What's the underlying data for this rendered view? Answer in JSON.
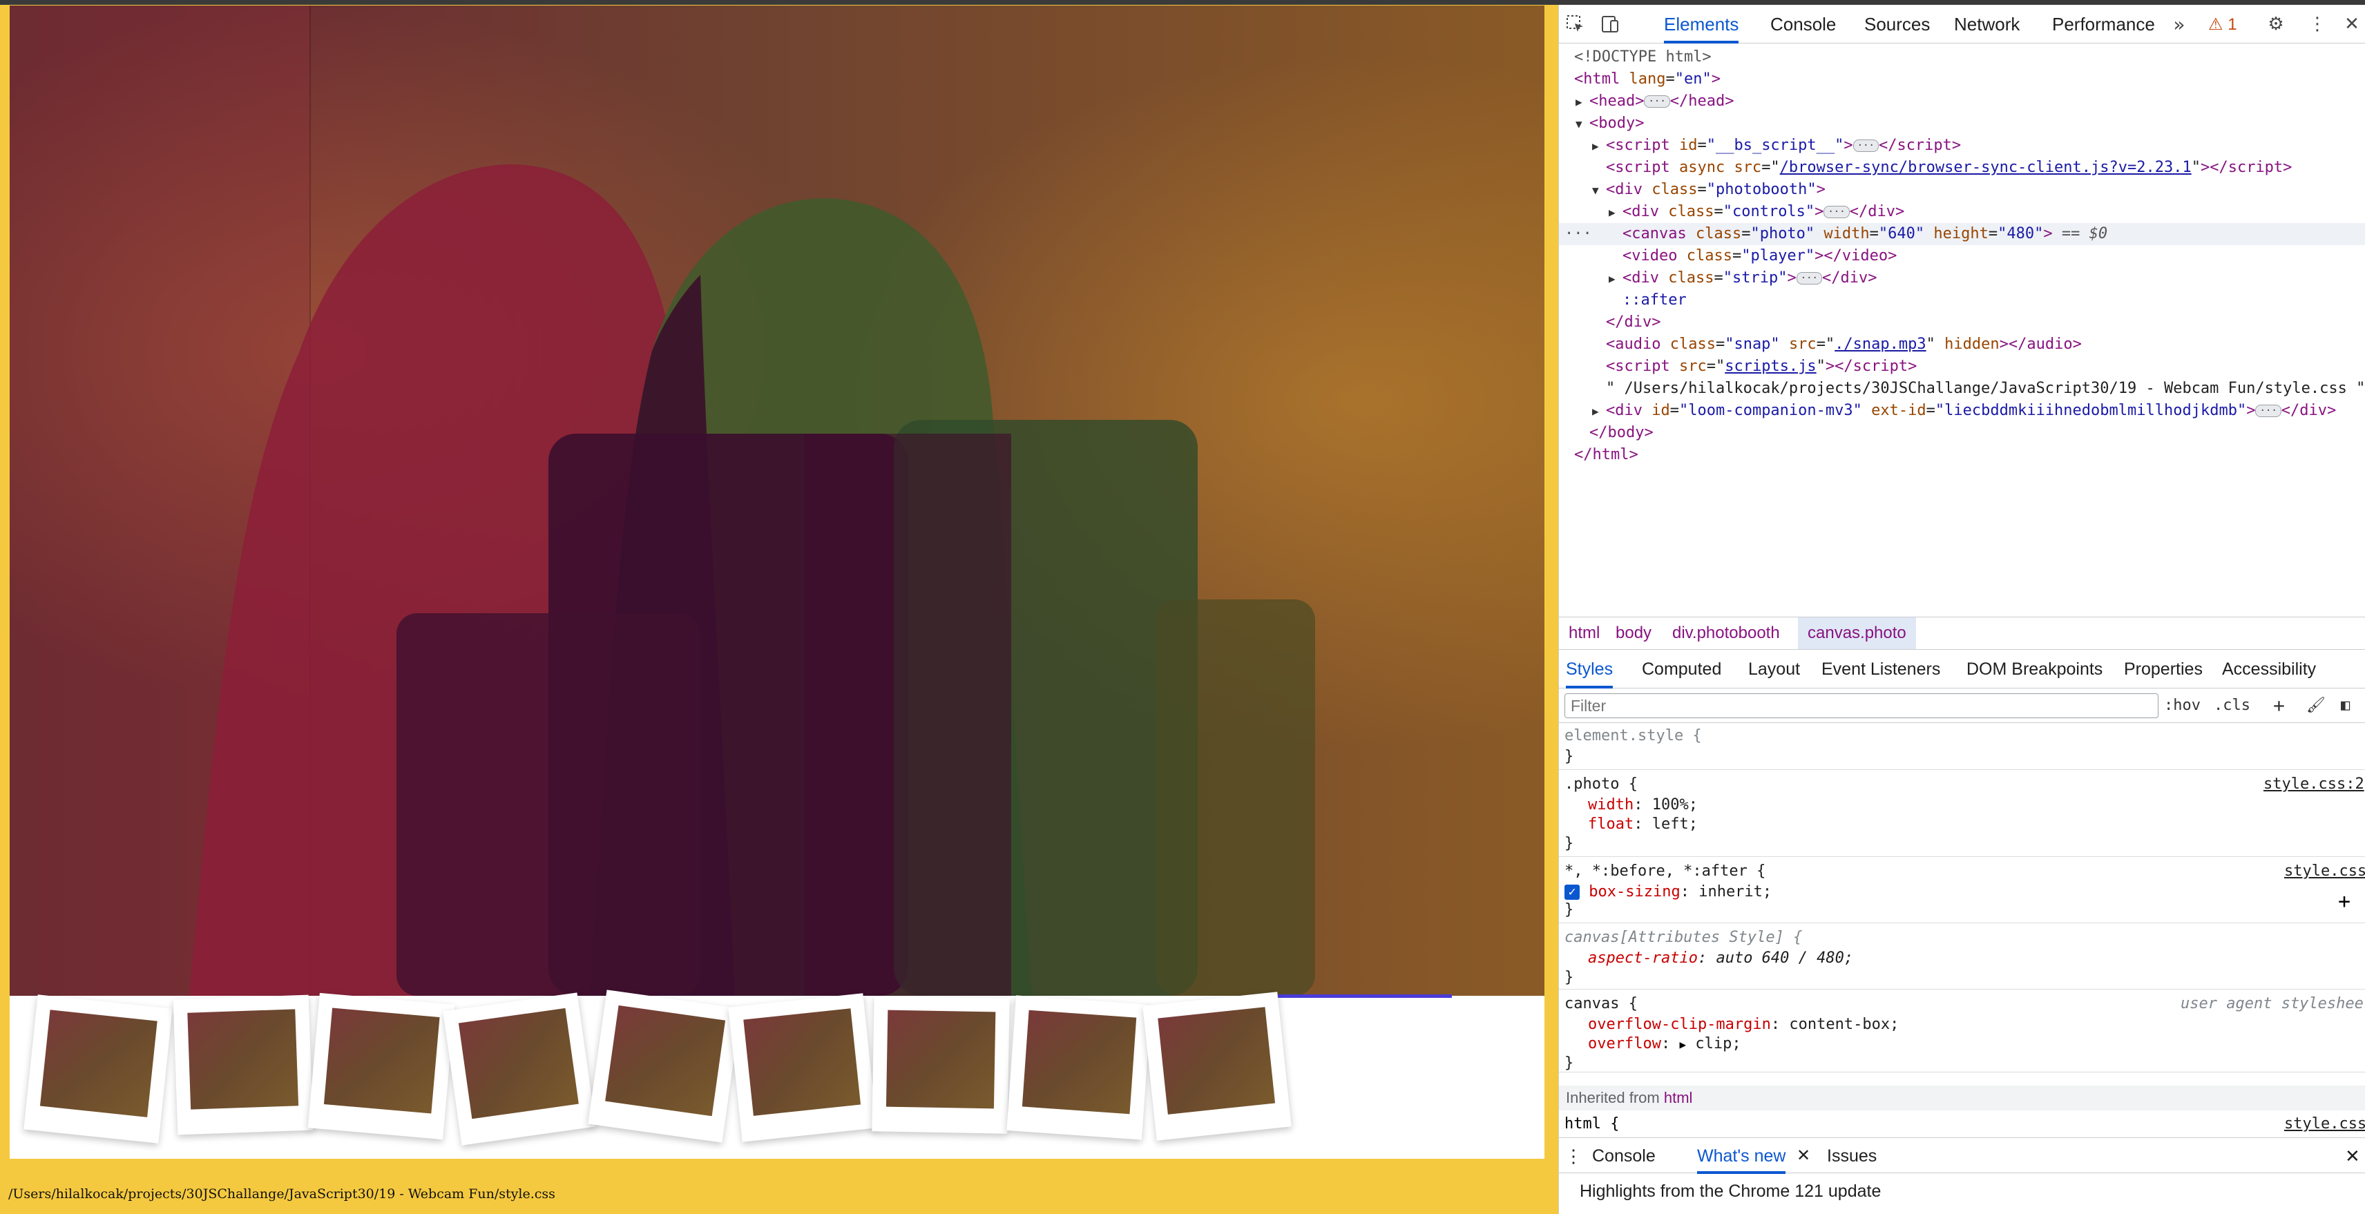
{
  "preview": {
    "footer_path": "/Users/hilalkocak/projects/30JSChallange/JavaScript30/19 - Webcam Fun/style.css",
    "strip_count": 9
  },
  "devtools": {
    "tabs": [
      "Elements",
      "Console",
      "Sources",
      "Network",
      "Performance"
    ],
    "active_tab": "Elements",
    "more_tabs_icon": "chevrons-right-icon",
    "warning_count": "1",
    "dom": {
      "doctype": "<!DOCTYPE html>",
      "html_open_tag": "html",
      "html_attr": "lang",
      "html_attr_val": "\"en\"",
      "head": "head",
      "body": "body",
      "bs_script_id": "\"__bs_script__\"",
      "async_src": "/browser-sync/browser-sync-client.js?v=2.23.1",
      "photobooth_class": "\"photobooth\"",
      "controls_class": "\"controls\"",
      "canvas_class": "\"photo\"",
      "canvas_width": "\"640\"",
      "canvas_height": "\"480\"",
      "selected_marker": "== $0",
      "video_class": "\"player\"",
      "strip_class": "\"strip\"",
      "after_pseudo": "::after",
      "audio_class": "\"snap\"",
      "audio_src": "./snap.mp3",
      "scripts_src": "scripts.js",
      "text_node": "\" /Users/hilalkocak/projects/30JSChallange/JavaScript30/19 - Webcam Fun/style.css \"",
      "loom_id": "\"loom-companion-mv3\"",
      "loom_ext_id": "\"liecbddmkiiihnedobmlmillhodjkdmb\""
    },
    "breadcrumb": [
      "html",
      "body",
      "div.photobooth",
      "canvas.photo"
    ],
    "sub_tabs": [
      "Styles",
      "Computed",
      "Layout",
      "Event Listeners",
      "DOM Breakpoints",
      "Properties",
      "Accessibility"
    ],
    "filter_placeholder": "Filter",
    "hov_label": ":hov",
    "cls_label": ".cls",
    "rules": {
      "element_style": "element.style {",
      "close": "}",
      "photo_selector": ".photo {",
      "photo_source": "style.css:2",
      "width_prop": "width",
      "width_val": "100%;",
      "float_prop": "float",
      "float_val": "left;",
      "universal_selector": "*, *:before, *:after {",
      "universal_source": "style.css:",
      "boxsizing_prop": "box-sizing",
      "boxsizing_val": "inherit;",
      "canvas_attr_selector": "canvas[Attributes Style] {",
      "aspect_prop": "aspect-ratio",
      "aspect_val": "auto 640 / 480;",
      "canvas_selector": "canvas {",
      "ua_source": "user agent styleshee",
      "ocm_prop": "overflow-clip-margin",
      "ocm_val": "content-box;",
      "overflow_prop": "overflow",
      "overflow_val": "clip;",
      "inherited_label": "Inherited from",
      "inherited_from": "html",
      "html_selector": "html {",
      "html_source": "style.css:"
    },
    "drawer_tabs": [
      "Console",
      "What's new",
      "Issues"
    ],
    "drawer_active": "What's new",
    "drawer_content": "Highlights from the Chrome 121 update"
  }
}
